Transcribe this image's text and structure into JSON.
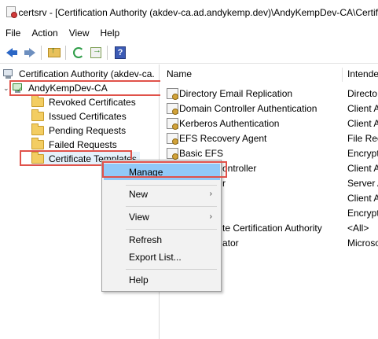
{
  "window": {
    "title": "certsrv - [Certification Authority (akdev-ca.ad.andykemp.dev)\\AndyKempDev-CA\\Certif"
  },
  "menubar": {
    "items": [
      "File",
      "Action",
      "View",
      "Help"
    ]
  },
  "toolbar": {
    "icons": [
      "back-arrow-icon",
      "forward-arrow-icon",
      "up-folder-icon",
      "refresh-icon",
      "export-list-icon",
      "help-icon"
    ],
    "help_glyph": "?"
  },
  "tree": {
    "root_label": "Certification Authority (akdev-ca.",
    "ca_label": "AndyKempDev-CA",
    "folders": [
      "Revoked Certificates",
      "Issued Certificates",
      "Pending Requests",
      "Failed Requests",
      "Certificate Templates"
    ],
    "expander": "⌄"
  },
  "list": {
    "columns": [
      "Name",
      "Intende"
    ],
    "rows": [
      {
        "name": "Directory Email Replication",
        "purpose": "Directo",
        "icon": true
      },
      {
        "name": "Domain Controller Authentication",
        "purpose": "Client A",
        "icon": true
      },
      {
        "name": "Kerberos Authentication",
        "purpose": "Client A",
        "icon": true
      },
      {
        "name": "EFS Recovery Agent",
        "purpose": "File Rec",
        "icon": true
      },
      {
        "name": "Basic EFS",
        "purpose": "Encrypt",
        "icon": true
      },
      {
        "name": "ontroller",
        "purpose": "Client A",
        "icon": false
      },
      {
        "name": "r",
        "purpose": "Server A",
        "icon": false
      },
      {
        "name": "",
        "purpose": "Client A",
        "icon": false
      },
      {
        "name": "",
        "purpose": "Encrypt",
        "icon": false
      },
      {
        "name": "te Certification Authority",
        "purpose": "<All>",
        "icon": false
      },
      {
        "name": "ator",
        "purpose": "Microso",
        "icon": false
      }
    ]
  },
  "context_menu": {
    "items": [
      {
        "label": "Manage",
        "active": true
      },
      {
        "label": "New",
        "submenu": true
      },
      {
        "label": "View",
        "submenu": true
      },
      {
        "label": "Refresh"
      },
      {
        "label": "Export List..."
      },
      {
        "label": "Help"
      }
    ],
    "submenu_glyph": "›"
  },
  "colors": {
    "highlight_box": "#e0524a",
    "menu_active": "#91c9f7"
  }
}
